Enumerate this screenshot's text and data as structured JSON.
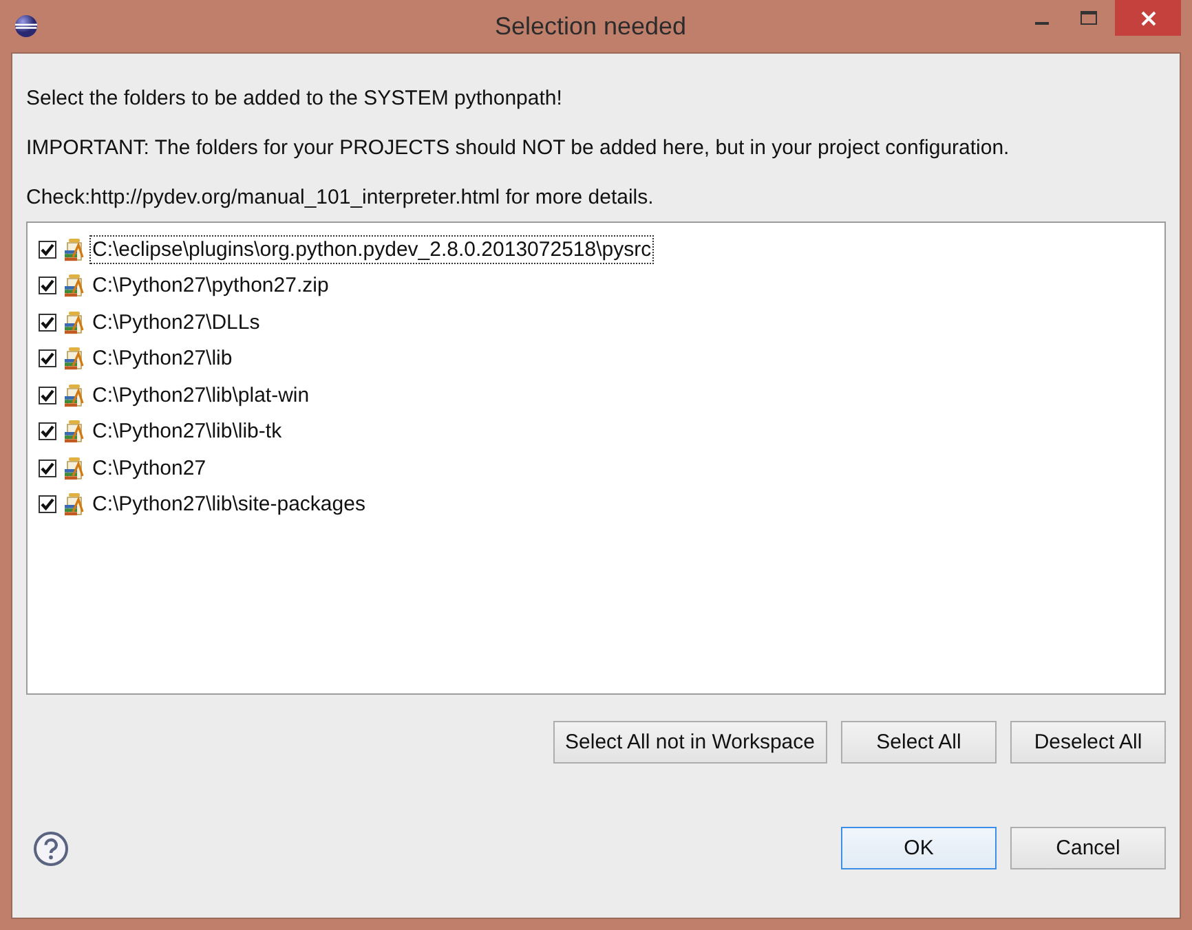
{
  "window": {
    "title": "Selection needed"
  },
  "messages": [
    "Select the folders to be added to the SYSTEM pythonpath!",
    "IMPORTANT: The folders for your PROJECTS should NOT be added here, but in your project configuration.",
    "Check:http://pydev.org/manual_101_interpreter.html for more details."
  ],
  "folders": [
    {
      "path": "C:\\eclipse\\plugins\\org.python.pydev_2.8.0.2013072518\\pysrc",
      "checked": true,
      "focused": true
    },
    {
      "path": "C:\\Python27\\python27.zip",
      "checked": true,
      "focused": false
    },
    {
      "path": "C:\\Python27\\DLLs",
      "checked": true,
      "focused": false
    },
    {
      "path": "C:\\Python27\\lib",
      "checked": true,
      "focused": false
    },
    {
      "path": "C:\\Python27\\lib\\plat-win",
      "checked": true,
      "focused": false
    },
    {
      "path": "C:\\Python27\\lib\\lib-tk",
      "checked": true,
      "focused": false
    },
    {
      "path": "C:\\Python27",
      "checked": true,
      "focused": false
    },
    {
      "path": "C:\\Python27\\lib\\site-packages",
      "checked": true,
      "focused": false
    }
  ],
  "selection_buttons": [
    "Select All not in Workspace",
    "Select All",
    "Deselect All"
  ],
  "dialog_buttons": [
    {
      "label": "OK",
      "default": true
    },
    {
      "label": "Cancel",
      "default": false
    }
  ]
}
